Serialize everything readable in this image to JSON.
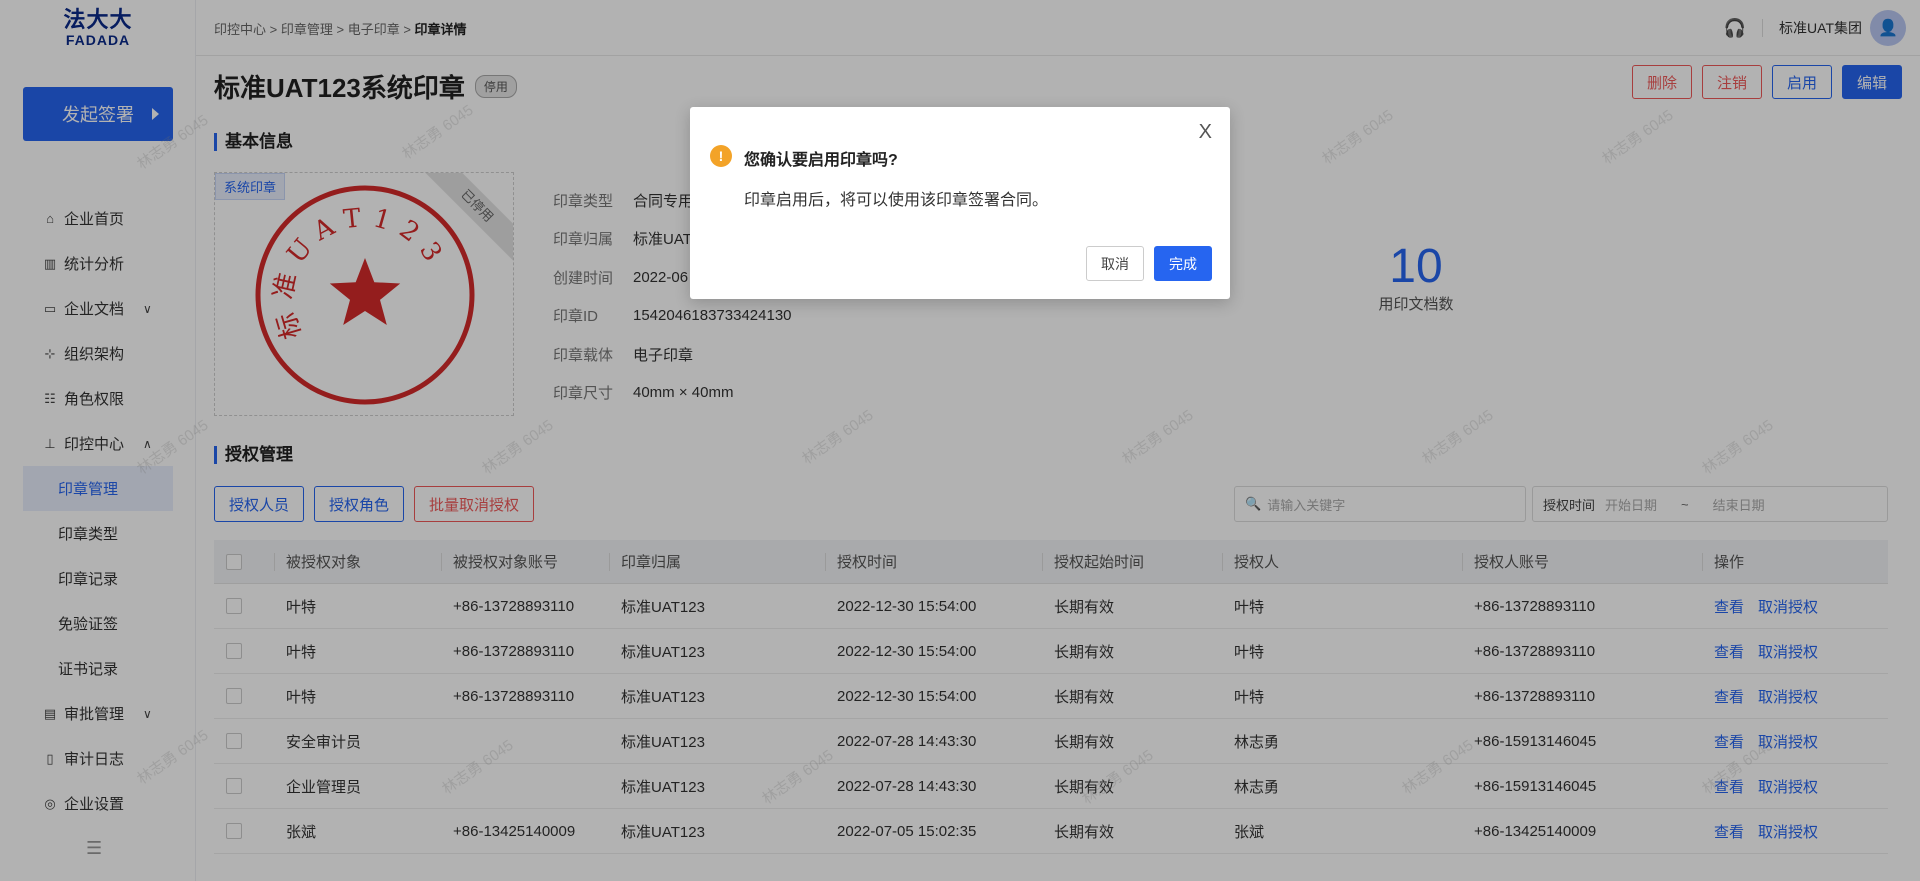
{
  "brand": {
    "line1": "法大大",
    "line2": "FADADA"
  },
  "sidebar": {
    "start_button": "发起签署",
    "items": [
      {
        "label": "企业首页",
        "icon": "home-icon",
        "glyph": "⌂"
      },
      {
        "label": "统计分析",
        "icon": "chart-icon",
        "glyph": "▥"
      },
      {
        "label": "企业文档",
        "icon": "folder-icon",
        "glyph": "▭",
        "chevron": "∨"
      },
      {
        "label": "组织架构",
        "icon": "org-icon",
        "glyph": "⊹"
      },
      {
        "label": "角色权限",
        "icon": "role-icon",
        "glyph": "☷"
      },
      {
        "label": "印控中心",
        "icon": "stamp-icon",
        "glyph": "⊥",
        "chevron": "∧"
      }
    ],
    "sub_items": [
      "印章管理",
      "印章类型",
      "印章记录",
      "免验证签",
      "证书记录"
    ],
    "items_after": [
      {
        "label": "审批管理",
        "icon": "approval-icon",
        "glyph": "▤",
        "chevron": "∨"
      },
      {
        "label": "审计日志",
        "icon": "log-icon",
        "glyph": "▯"
      },
      {
        "label": "企业设置",
        "icon": "settings-icon",
        "glyph": "◎"
      }
    ]
  },
  "header": {
    "breadcrumb": [
      "印控中心",
      "印章管理",
      "电子印章"
    ],
    "breadcrumb_current": "印章详情",
    "org_name": "标准UAT集团"
  },
  "page": {
    "title": "标准UAT123系统印章",
    "status_badge": "停用",
    "actions": {
      "delete": "删除",
      "cancel": "注销",
      "enable": "启用",
      "edit": "编辑"
    }
  },
  "basic_info": {
    "section_title": "基本信息",
    "seal_tag": "系统印章",
    "ribbon": "已停用",
    "seal_text": "标准UAT123",
    "fields": [
      {
        "key": "印章类型",
        "value": "合同专用"
      },
      {
        "key": "印章归属",
        "value": "标准UAT"
      },
      {
        "key": "创建时间",
        "value": "2022-06"
      },
      {
        "key": "印章ID",
        "value": "1542046183733424130"
      },
      {
        "key": "印章载体",
        "value": "电子印章"
      },
      {
        "key": "印章尺寸",
        "value": "40mm × 40mm"
      }
    ],
    "stat_value": "10",
    "stat_label": "用印文档数"
  },
  "auth": {
    "section_title": "授权管理",
    "buttons": {
      "auth_person": "授权人员",
      "auth_role": "授权角色",
      "batch_cancel": "批量取消授权"
    },
    "search_placeholder": "请输入关键字",
    "date_label": "授权时间",
    "date_start": "开始日期",
    "date_sep": "~",
    "date_end": "结束日期",
    "columns": [
      "被授权对象",
      "被授权对象账号",
      "印章归属",
      "授权时间",
      "授权起始时间",
      "授权人",
      "授权人账号",
      "操作"
    ],
    "rows": [
      [
        "叶特",
        "+86-13728893110",
        "标准UAT123",
        "2022-12-30 15:54:00",
        "长期有效",
        "叶特",
        "+86-13728893110"
      ],
      [
        "叶特",
        "+86-13728893110",
        "标准UAT123",
        "2022-12-30 15:54:00",
        "长期有效",
        "叶特",
        "+86-13728893110"
      ],
      [
        "叶特",
        "+86-13728893110",
        "标准UAT123",
        "2022-12-30 15:54:00",
        "长期有效",
        "叶特",
        "+86-13728893110"
      ],
      [
        "安全审计员",
        "",
        "标准UAT123",
        "2022-07-28 14:43:30",
        "长期有效",
        "林志勇",
        "+86-15913146045"
      ],
      [
        "企业管理员",
        "",
        "标准UAT123",
        "2022-07-28 14:43:30",
        "长期有效",
        "林志勇",
        "+86-15913146045"
      ],
      [
        "张斌",
        "+86-13425140009",
        "标准UAT123",
        "2022-07-05 15:02:35",
        "长期有效",
        "张斌",
        "+86-13425140009"
      ]
    ],
    "row_actions": {
      "view": "查看",
      "cancel": "取消授权"
    }
  },
  "watermark_text": "林志勇 6045",
  "modal": {
    "title": "您确认要启用印章吗?",
    "body": "印章启用后，将可以使用该印章签署合同。",
    "cancel": "取消",
    "confirm": "完成",
    "close": "X"
  },
  "colors": {
    "primary": "#2665f0",
    "danger": "#ef5a5a",
    "warning": "#f3a328",
    "seal_red": "#d42a2a"
  }
}
